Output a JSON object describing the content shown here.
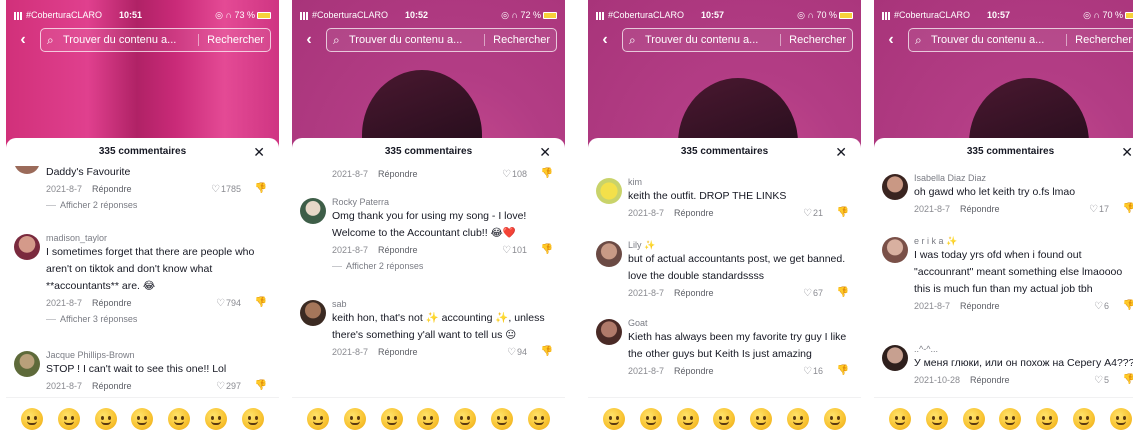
{
  "common": {
    "carrier": "#CoberturaCLARO",
    "search_placeholder": "Trouver du contenu a...",
    "search_button": "Rechercher",
    "comments_title": "335 commentaires",
    "close": "✕",
    "reply_label": "Répondre",
    "back": "‹"
  },
  "phones": [
    {
      "time": "10:51",
      "battery": "73 %",
      "comments": [
        {
          "user": "",
          "text": "Daddy's Favourite",
          "date": "2021-8-7",
          "likes": "1785",
          "replies": "Afficher 2 réponses"
        },
        {
          "user": "madison_taylor",
          "text": "I sometimes forget that there are people who aren't on tiktok and don't know what **accountants** are. 😂",
          "date": "2021-8-7",
          "likes": "794",
          "replies": "Afficher 3 réponses"
        },
        {
          "user": "Jacque Phillips-Brown",
          "text": "STOP ! I can't wait to see this one!! Lol",
          "date": "2021-8-7",
          "likes": "297",
          "replies": ""
        }
      ]
    },
    {
      "time": "10:52",
      "battery": "72 %",
      "comments": [
        {
          "user": "",
          "text": "",
          "date": "2021-8-7",
          "likes": "108",
          "replies": ""
        },
        {
          "user": "Rocky Paterra",
          "text": "Omg thank you for using my song - I love! Welcome to the Accountant club!! 😂❤️",
          "date": "2021-8-7",
          "likes": "101",
          "replies": "Afficher 2 réponses"
        },
        {
          "user": "sab",
          "text": "keith hon, that's not ✨ accounting ✨, unless there's something y'all want to tell us 😐",
          "date": "2021-8-7",
          "likes": "94",
          "replies": ""
        }
      ]
    },
    {
      "time": "10:57",
      "battery": "70 %",
      "comments": [
        {
          "user": "kim",
          "text": "keith the outfit. DROP THE LINKS",
          "date": "2021-8-7",
          "likes": "21",
          "replies": ""
        },
        {
          "user": "Lily ✨",
          "text": "but of actual accountants post, we get banned. love the double standardssss",
          "date": "2021-8-7",
          "likes": "67",
          "replies": ""
        },
        {
          "user": "Goat",
          "text": "Kieth has always been my favorite try guy I like the other guys but Keith Is just amazing",
          "date": "2021-8-7",
          "likes": "16",
          "replies": ""
        }
      ]
    },
    {
      "time": "10:57",
      "battery": "70 %",
      "comments": [
        {
          "user": "Isabella Diaz Diaz",
          "text": "oh gawd who let keith try o.fs lmao",
          "date": "2021-8-7",
          "likes": "17",
          "replies": ""
        },
        {
          "user": "e r i k a ✨",
          "text": "I was today yrs ofd when i found out \"accounrant\" meant something else lmaoooo this is much fun than my actual job tbh",
          "date": "2021-8-7",
          "likes": "6",
          "replies": ""
        },
        {
          "user": "..^-^...",
          "text": "У меня глюки, или он похож на Серегу А4???",
          "date": "2021-10-28",
          "likes": "5",
          "replies": ""
        }
      ]
    }
  ],
  "colors": {
    "accent_video": "#c93a86",
    "text": "#161823",
    "meta": "#8a8b91"
  },
  "emoji_count": 7
}
